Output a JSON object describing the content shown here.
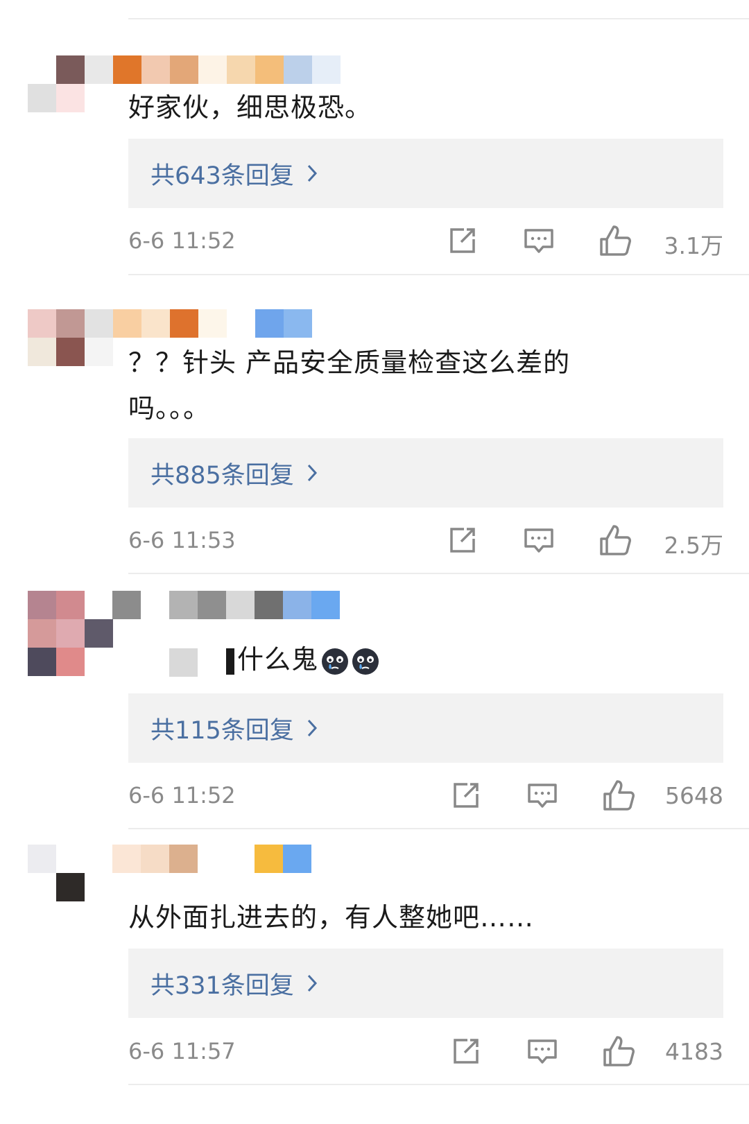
{
  "colors": {
    "reply_text": "#4a6fa1",
    "reply_bg": "#f2f2f2",
    "meta_text": "#8a8a8a",
    "body_text": "#1a1a1a"
  },
  "icons": [
    "share-icon",
    "comment-icon",
    "like-icon",
    "chevron-right-icon",
    "crying-emoji-icon"
  ],
  "comments": [
    {
      "text": "好家伙，细思极恐。",
      "replies_label": "共643条回复",
      "time": "6-6 11:52",
      "likes": "3.1万"
    },
    {
      "text": "？？针头 产品安全质量检查这么差的吗。。。",
      "replies_label": "共885条回复",
      "time": "6-6 11:53",
      "likes": "2.5万"
    },
    {
      "text": "什么鬼",
      "replies_label": "共115条回复",
      "time": "6-6 11:52",
      "likes": "5648"
    },
    {
      "text": "从外面扎进去的，有人整她吧……",
      "replies_label": "共331条回复",
      "time": "6-6 11:57",
      "likes": "4183"
    }
  ]
}
